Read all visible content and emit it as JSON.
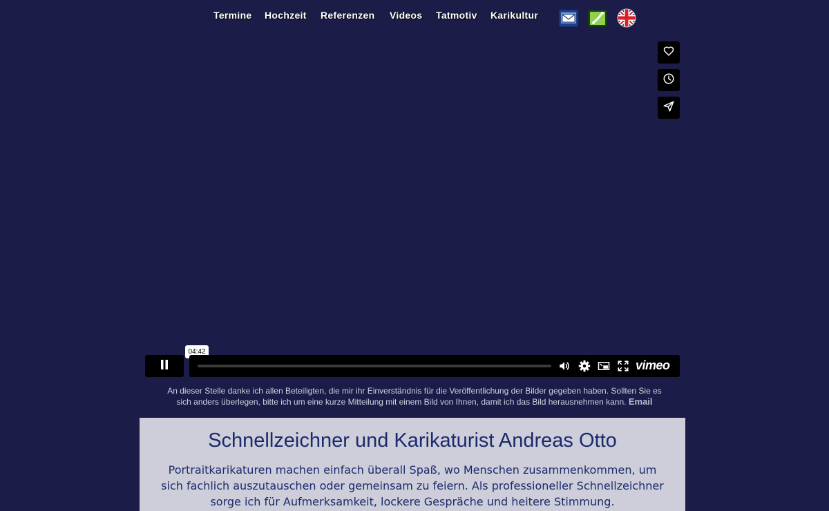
{
  "nav": {
    "links": [
      "Termine",
      "Hochzeit",
      "Referenzen",
      "Videos",
      "Tatmotiv",
      "Karikultur"
    ],
    "icons": [
      "mail-icon",
      "phone-icon",
      "uk-flag-icon"
    ]
  },
  "video": {
    "side_actions": [
      "heart-icon",
      "clock-icon",
      "send-icon"
    ],
    "time_tooltip": "04:42",
    "progress": 0.0,
    "control_icons": [
      "pause-icon",
      "volume-icon",
      "settings-icon",
      "pip-icon",
      "fullscreen-icon"
    ],
    "brand": "vimeo"
  },
  "note": {
    "text": "An dieser Stelle danke ich allen Beteiligten, die mir ihr Einverständnis für die Veröffentlichung der Bilder gegeben haben. Sollten Sie es sich anders überlegen, bitte ich um  eine kurze Mitteilung mit einem Bild von Ihnen, damit ich das Bild herausnehmen kann.",
    "link": "Email"
  },
  "content": {
    "title": "Schnellzeichner und Karikaturist Andreas Otto",
    "paragraph": "Portraitkarikaturen machen einfach überall Spaß, wo Menschen zusammenkommen, um sich fachlich auszutauschen oder gemeinsam zu feiern. Als professioneller Schnellzeichner sorge ich für Aufmerksamkeit, lockere Gespräche und heitere Stimmung."
  },
  "colors": {
    "background": "#1b1c48",
    "content_box": "#cdced9",
    "heading": "#1a2a6c",
    "player_bar": "#000000"
  }
}
